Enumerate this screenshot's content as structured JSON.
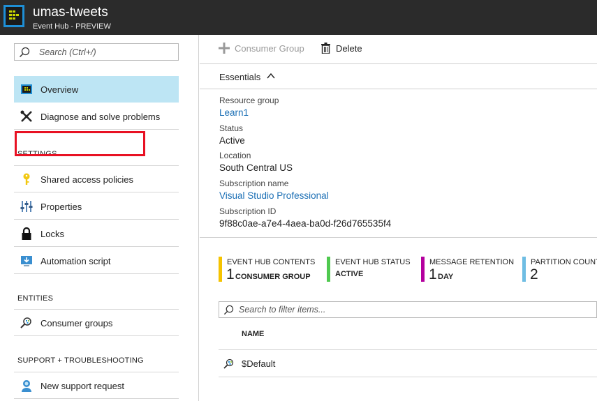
{
  "header": {
    "title": "umas-tweets",
    "subtitle": "Event Hub - PREVIEW",
    "icon": "event-hub-icon"
  },
  "sidebar": {
    "search_placeholder": "Search (Ctrl+/)",
    "items": [
      {
        "label": "Overview",
        "icon": "overview-icon",
        "active": true
      },
      {
        "label": "Diagnose and solve problems",
        "icon": "tools-icon"
      },
      {
        "label": "Shared access policies",
        "icon": "key-icon"
      },
      {
        "label": "Properties",
        "icon": "properties-icon"
      },
      {
        "label": "Locks",
        "icon": "lock-icon"
      },
      {
        "label": "Automation script",
        "icon": "download-icon"
      },
      {
        "label": "Consumer groups",
        "icon": "consumer-groups-icon"
      },
      {
        "label": "New support request",
        "icon": "support-icon"
      }
    ],
    "sections": {
      "settings": "SETTINGS",
      "entities": "ENTITIES",
      "support": "SUPPORT + TROUBLESHOOTING"
    },
    "highlight_color": "#e81123"
  },
  "toolbar": {
    "consumer_group_label": "Consumer Group",
    "delete_label": "Delete"
  },
  "essentials": {
    "label": "Essentials",
    "properties": [
      {
        "label": "Resource group",
        "value": "Learn1",
        "link": true
      },
      {
        "label": "Status",
        "value": "Active",
        "link": false
      },
      {
        "label": "Location",
        "value": "South Central US",
        "link": false
      },
      {
        "label": "Subscription name",
        "value": "Visual Studio Professional",
        "link": true
      },
      {
        "label": "Subscription ID",
        "value": "9f88c0ae-a7e4-4aea-ba0d-f26d765535f4",
        "link": false
      }
    ]
  },
  "tiles": [
    {
      "label": "EVENT HUB CONTENTS",
      "number": "1",
      "unit": "CONSUMER GROUP",
      "color": "#f5c300"
    },
    {
      "label": "EVENT HUB STATUS",
      "number": "",
      "unit": "ACTIVE",
      "color": "#4fc94f"
    },
    {
      "label": "MESSAGE RETENTION",
      "number": "1",
      "unit": "DAY",
      "color": "#b4009e"
    },
    {
      "label": "PARTITION COUNT",
      "number": "2",
      "unit": "",
      "color": "#6fbde3"
    }
  ],
  "consumer_groups": {
    "filter_placeholder": "Search to filter items...",
    "column_name": "NAME",
    "rows": [
      {
        "name": "$Default"
      }
    ]
  }
}
